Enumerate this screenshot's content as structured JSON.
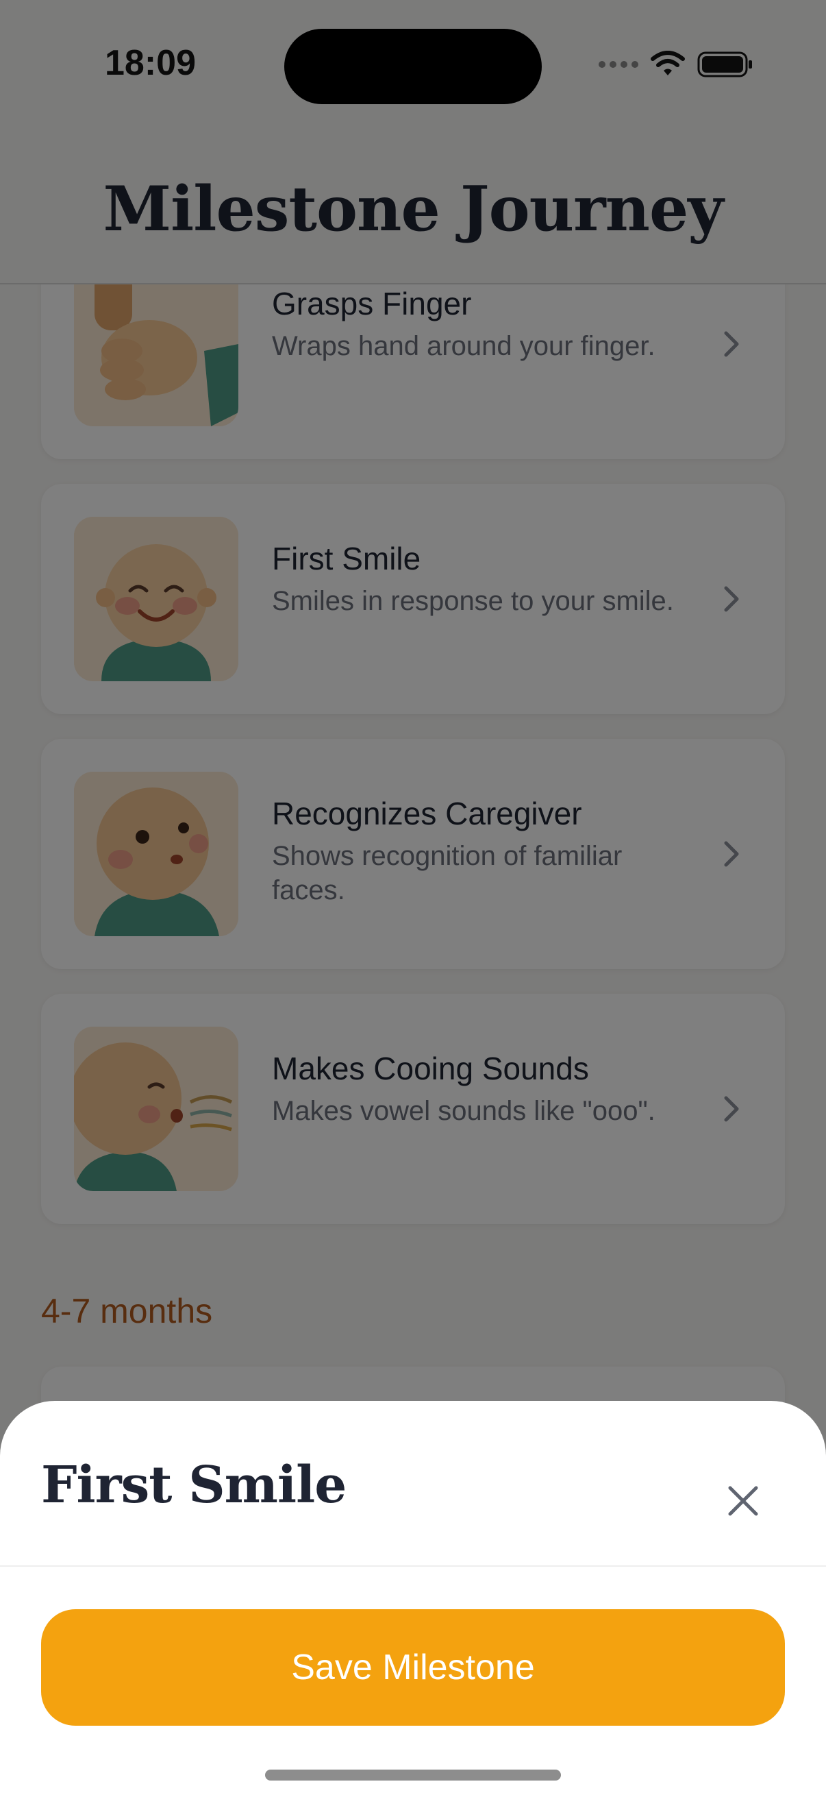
{
  "status_bar": {
    "time": "18:09"
  },
  "header": {
    "title": "Milestone Journey"
  },
  "milestones": [
    {
      "title": "Grasps Finger",
      "description": "Wraps hand around your finger.",
      "icon": "baby-grasping-finger-illustration"
    },
    {
      "title": "First Smile",
      "description": "Smiles in response to your smile.",
      "icon": "baby-smiling-illustration"
    },
    {
      "title": "Recognizes Caregiver",
      "description": "Shows recognition of familiar faces.",
      "icon": "baby-looking-up-illustration"
    },
    {
      "title": "Makes Cooing Sounds",
      "description": "Makes vowel sounds like \"ooo\".",
      "icon": "baby-cooing-illustration"
    }
  ],
  "next_section": {
    "label": "4-7 months"
  },
  "sheet": {
    "title": "First Smile",
    "save_label": "Save Milestone"
  },
  "colors": {
    "accent": "#f4a20f",
    "section_label": "#b05a1e",
    "title_text": "#1f2433"
  }
}
